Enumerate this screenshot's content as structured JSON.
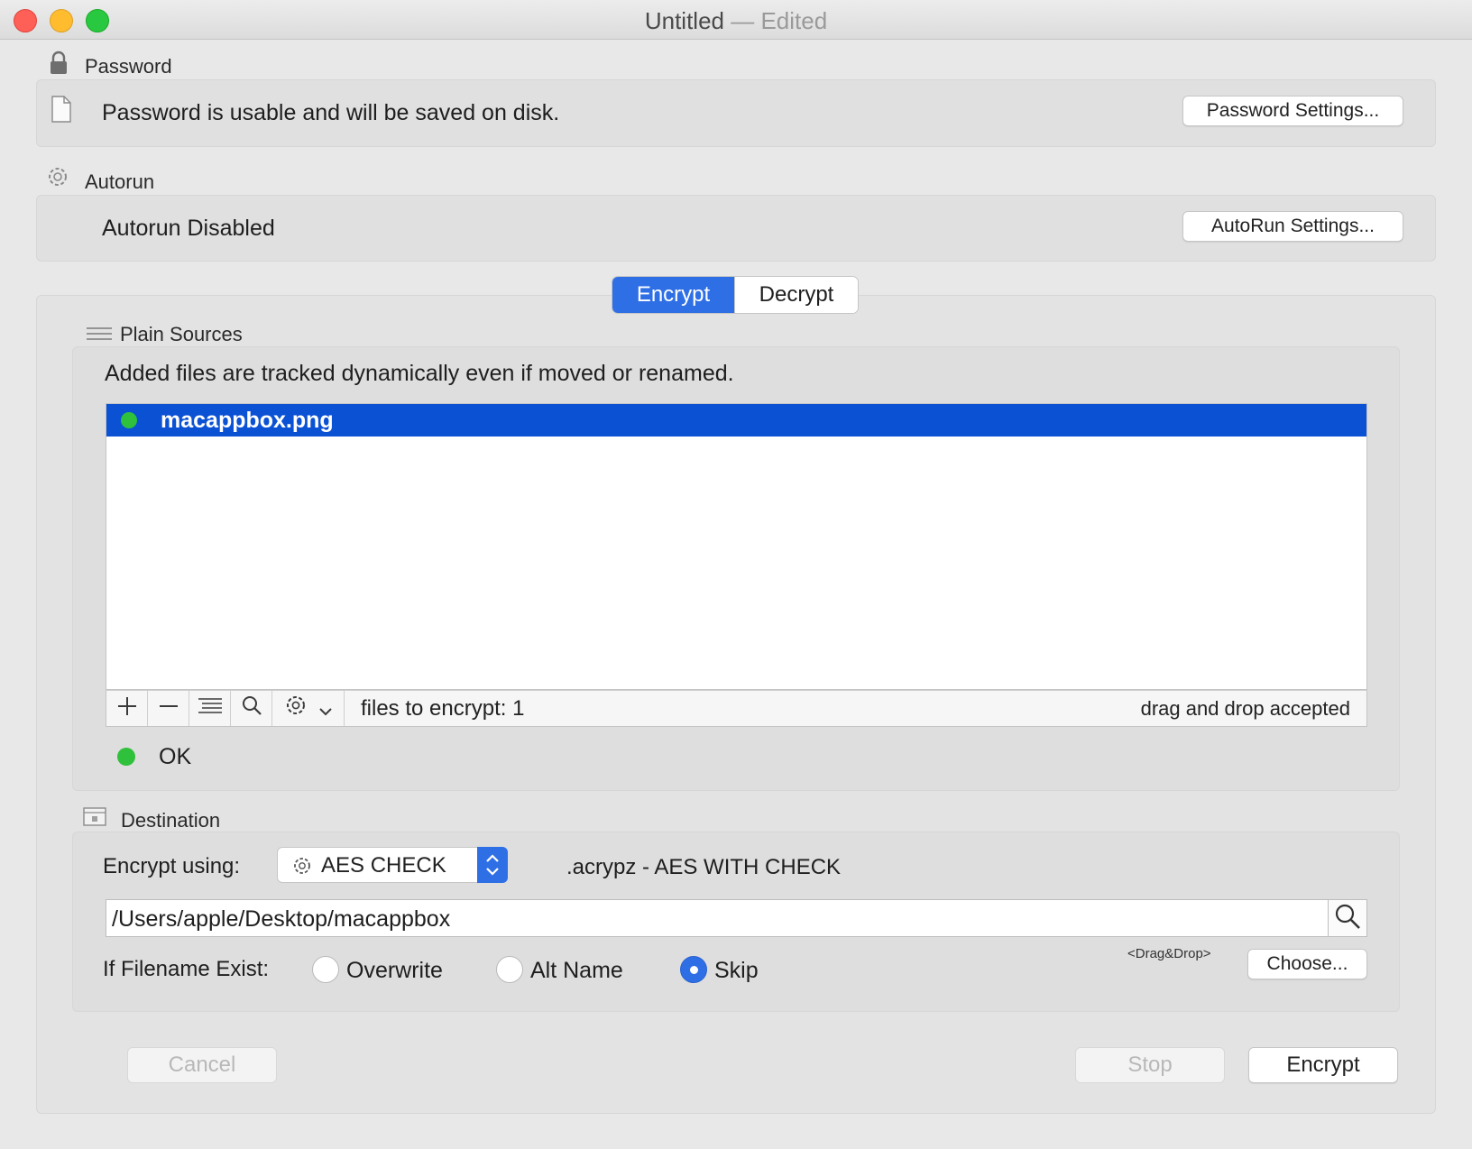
{
  "window": {
    "title": "Untitled",
    "title_suffix": "— Edited"
  },
  "password": {
    "section_label": "Password",
    "status_text": "Password is usable and will be saved on disk.",
    "settings_button": "Password Settings..."
  },
  "autorun": {
    "section_label": "Autorun",
    "status_text": "Autorun Disabled",
    "settings_button": "AutoRun Settings..."
  },
  "mode_tabs": {
    "encrypt": "Encrypt",
    "decrypt": "Decrypt",
    "selected": "Encrypt"
  },
  "plain_sources": {
    "section_label": "Plain Sources",
    "hint": "Added files are tracked dynamically  even if moved or renamed.",
    "files": [
      {
        "name": "macappbox.png",
        "status_color": "#2fc13c",
        "selected": true
      }
    ],
    "toolbar": {
      "count_text": "files to encrypt: 1",
      "drag_text": "drag and drop accepted",
      "icons": [
        "plus-icon",
        "minus-icon",
        "list-icon",
        "search-icon",
        "gear-icon",
        "chevron-down-icon"
      ]
    },
    "status": {
      "text": "OK",
      "color": "#2fc13c"
    }
  },
  "destination": {
    "section_label": "Destination",
    "encrypt_using_label": "Encrypt using:",
    "method_selected": "AES CHECK",
    "method_description": ".acrypz - AES WITH CHECK",
    "path_value": "/Users/apple/Desktop/macappbox",
    "drag_drop_hint": "<Drag&Drop>",
    "choose_button": "Choose...",
    "if_exist_label": "If Filename Exist:",
    "options": [
      "Overwrite",
      "Alt Name",
      "Skip"
    ],
    "selected_option": "Skip"
  },
  "actions": {
    "cancel": "Cancel",
    "stop": "Stop",
    "encrypt": "Encrypt"
  },
  "colors": {
    "accent": "#2f6fe6",
    "selection": "#0b51d4",
    "ok_green": "#2fc13c"
  }
}
